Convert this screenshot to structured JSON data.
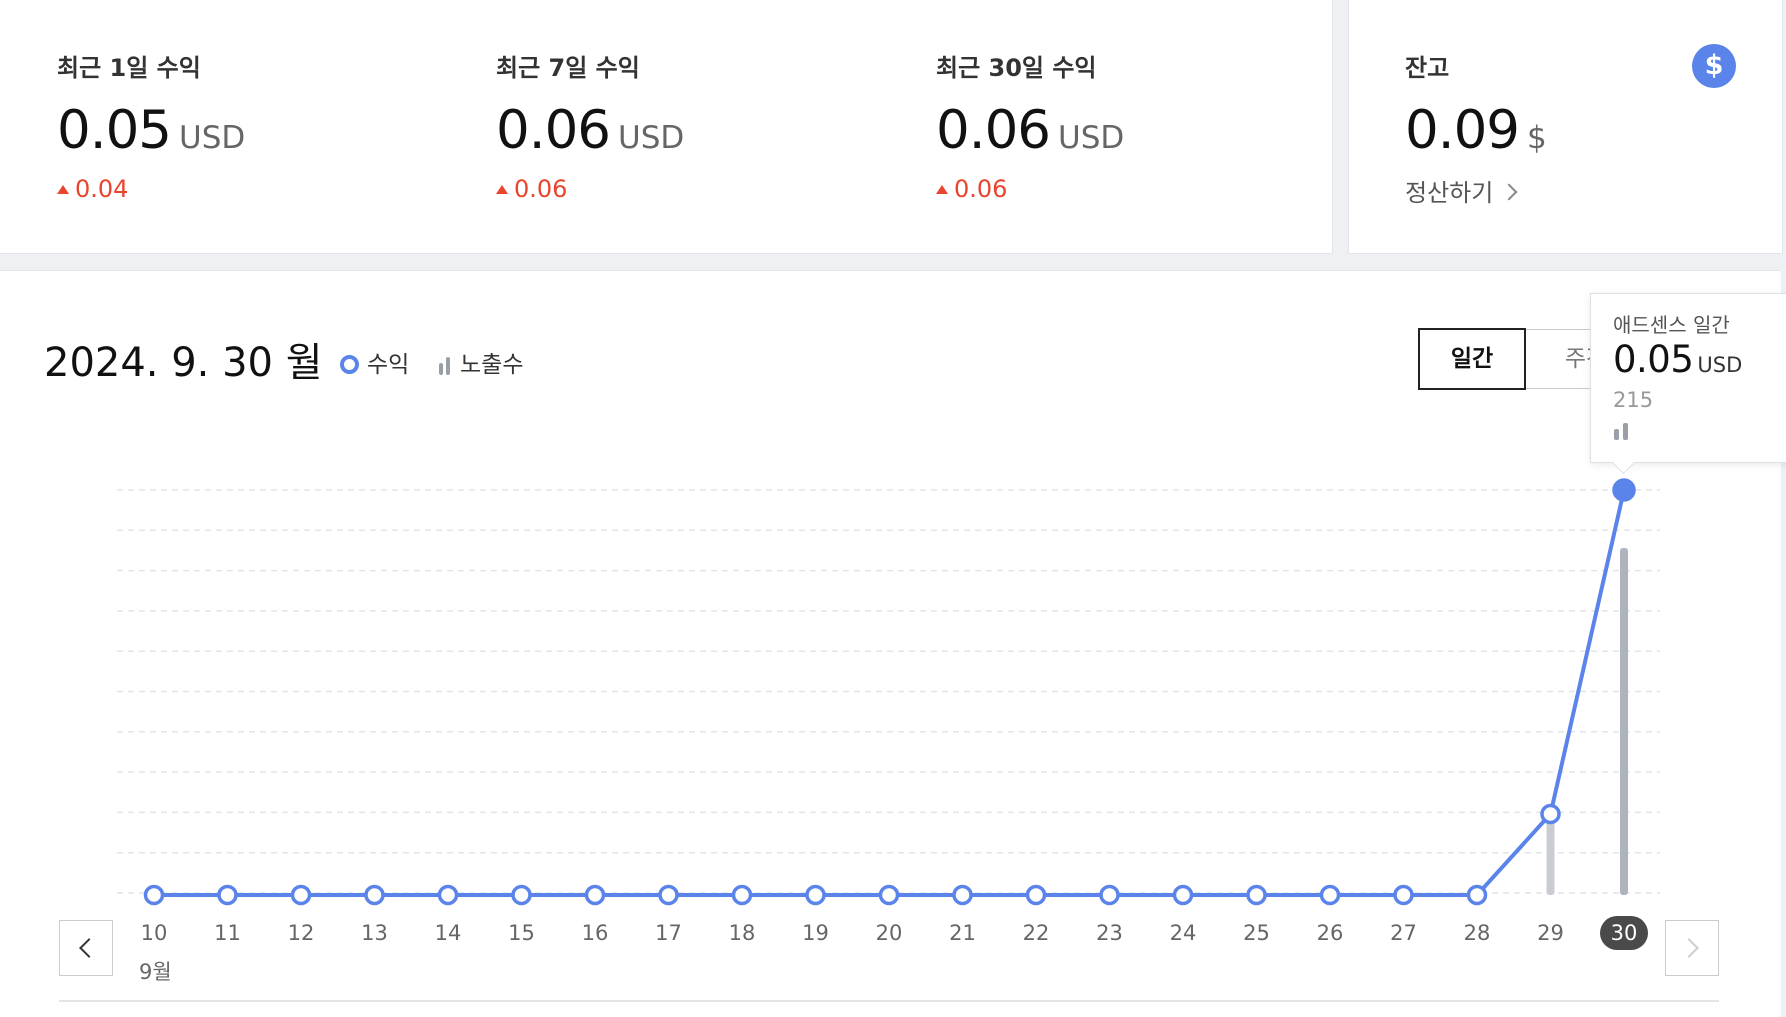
{
  "stats": [
    {
      "label": "최근 1일 수익",
      "value": "0.05",
      "unit": "USD",
      "change": "0.04"
    },
    {
      "label": "최근 7일 수익",
      "value": "0.06",
      "unit": "USD",
      "change": "0.06"
    },
    {
      "label": "최근 30일 수익",
      "value": "0.06",
      "unit": "USD",
      "change": "0.06"
    }
  ],
  "balance": {
    "label": "잔고",
    "value": "0.09",
    "unit": "$",
    "settle_label": "정산하기",
    "badge_symbol": "$",
    "badge_color": "#5b84ea"
  },
  "chart": {
    "date_title": "2024. 9. 30 월",
    "legend_revenue": "수익",
    "legend_impressions": "노출수",
    "period_daily": "일간",
    "period_weekly": "주간",
    "month_label": "9월",
    "tooltip": {
      "label": "애드센스 일간",
      "value": "0.05",
      "unit": "USD",
      "impressions": "215"
    }
  },
  "colors": {
    "revenue_line": "#5b84ea",
    "impressions_bar": "#b7bcc4",
    "change_up": "#e8442e"
  },
  "chart_data": {
    "type": "line",
    "categories": [
      "10",
      "11",
      "12",
      "13",
      "14",
      "15",
      "16",
      "17",
      "18",
      "19",
      "20",
      "21",
      "22",
      "23",
      "24",
      "25",
      "26",
      "27",
      "28",
      "29",
      "30"
    ],
    "series": [
      {
        "name": "수익",
        "values": [
          0,
          0,
          0,
          0,
          0,
          0,
          0,
          0,
          0,
          0,
          0,
          0,
          0,
          0,
          0,
          0,
          0,
          0,
          0,
          0.01,
          0.05
        ]
      },
      {
        "name": "노출수",
        "values": [
          0,
          0,
          0,
          0,
          0,
          0,
          0,
          0,
          0,
          0,
          0,
          0,
          0,
          0,
          0,
          0,
          0,
          0,
          0,
          47,
          215
        ]
      }
    ],
    "selected": "30"
  }
}
